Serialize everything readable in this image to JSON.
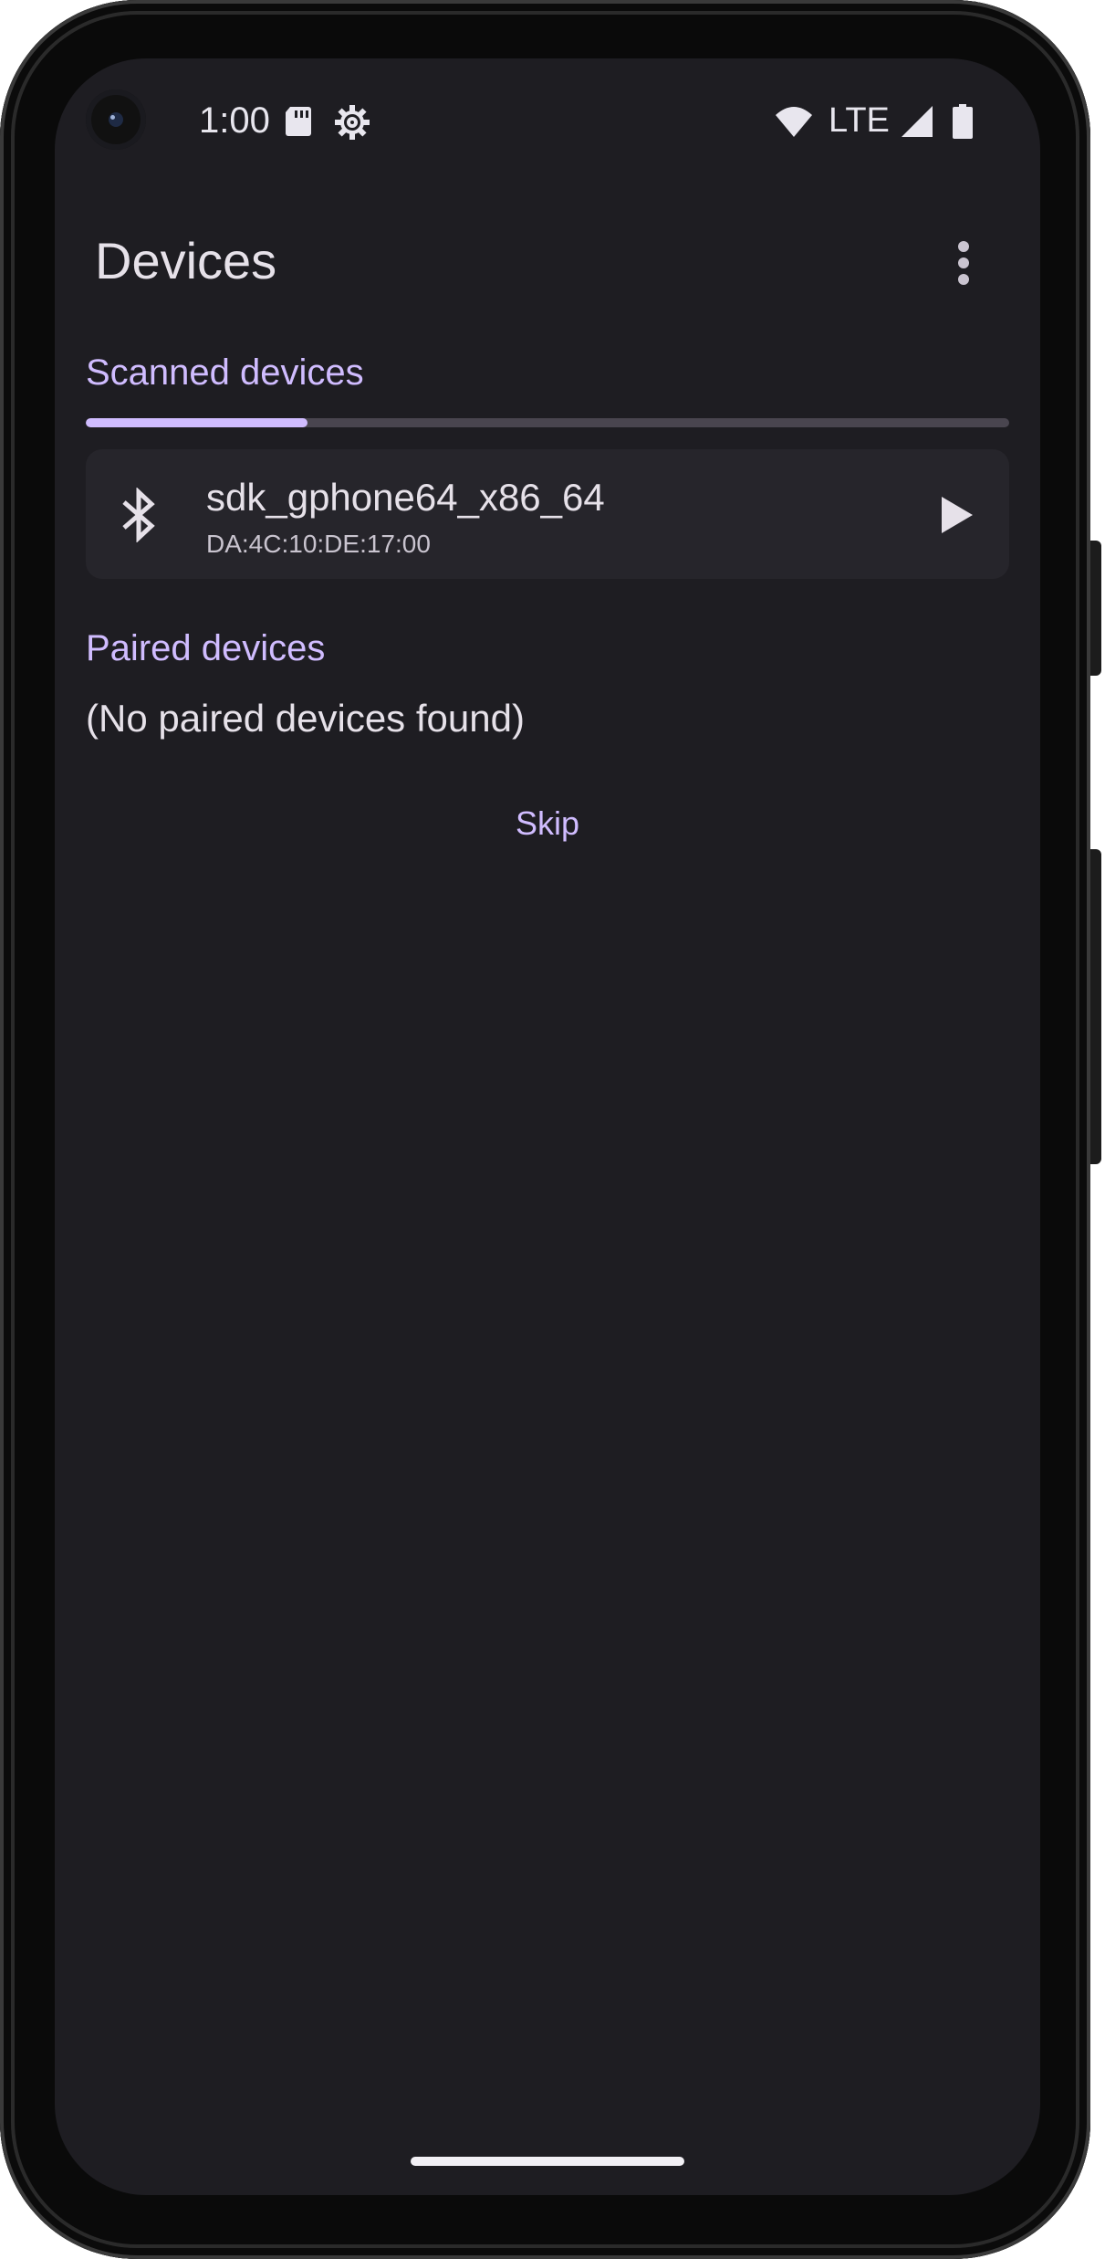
{
  "status_bar": {
    "time": "1:00",
    "network_label": "LTE",
    "icons": [
      "sd-card-icon",
      "gear-icon",
      "wifi-icon",
      "cell-signal-icon",
      "battery-icon"
    ]
  },
  "app_bar": {
    "title": "Devices",
    "menu_icon": "more-vert-icon"
  },
  "scanned_section": {
    "header": "Scanned devices",
    "progress": 0.24,
    "devices": [
      {
        "icon": "bluetooth-icon",
        "name": "sdk_gphone64_x86_64",
        "address": "DA:4C:10:DE:17:00",
        "action_icon": "play-icon"
      }
    ]
  },
  "paired_section": {
    "header": "Paired devices",
    "empty_message": "(No paired devices found)"
  },
  "actions": {
    "skip_label": "Skip"
  },
  "colors": {
    "background": "#1e1d22",
    "accent": "#d0bcff",
    "card": "#26252b",
    "text": "#e6e1e9"
  }
}
